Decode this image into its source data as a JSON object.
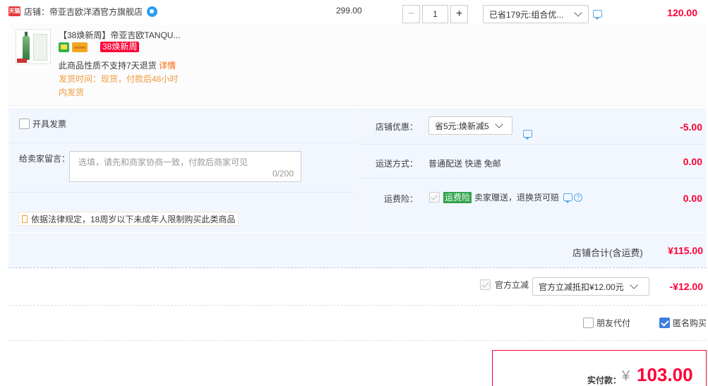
{
  "shop": {
    "badge": "天猫",
    "label": "店铺：帝亚吉欧洋酒官方旗舰店"
  },
  "item": {
    "title": "【38焕新周】帝亚吉欧TANQU...",
    "promo_tag": "38焕新周",
    "note": "此商品性质不支持7天退货",
    "note_link": "详情",
    "ship_time": "发货时间：现货，付款后48小时内发货",
    "unit_price": "299.00",
    "qty_minus": "−",
    "qty_value": "1",
    "qty_plus": "+",
    "discount_select": "已省179元:组合优...",
    "total": "120.00"
  },
  "options": {
    "invoice_label": "开具发票",
    "invoice_checked": false,
    "message_label": "给卖家留言：",
    "message_placeholder": "选填，请先和商家协商一致，付款后商家可见",
    "message_count": "0/200",
    "legal_notice": "依据法律规定，18周岁以下未成年人限制购买此类商品",
    "shop_discount_label": "店铺优惠：",
    "shop_discount_select": "省5元:焕新减5",
    "shop_discount_value": "-5.00",
    "shipping_label": "运送方式：",
    "shipping_value": "普通配送 快递 免邮",
    "shipping_amount": "0.00",
    "insurance_label": "运费险：",
    "insurance_badge": "运费险",
    "insurance_text": "卖家赠送，退换货可赔",
    "insurance_amount": "0.00",
    "help_glyph": "?"
  },
  "summary": {
    "shop_total_label": "店铺合计(含运费)",
    "shop_total_value": "¥115.00",
    "official_label": "官方立减",
    "official_select": "官方立减抵扣¥12.00元",
    "official_amount": "-¥12.00",
    "friend_pay_label": "朋友代付",
    "friend_pay_checked": false,
    "anonymous_label": "匿名购买",
    "anonymous_checked": true,
    "pay_label": "实付款：",
    "pay_currency": "¥",
    "pay_amount": "103.00"
  },
  "colors": {
    "accent_red": "#ff0036",
    "link_orange": "#f60",
    "panel_blue": "#f2f7ff"
  }
}
